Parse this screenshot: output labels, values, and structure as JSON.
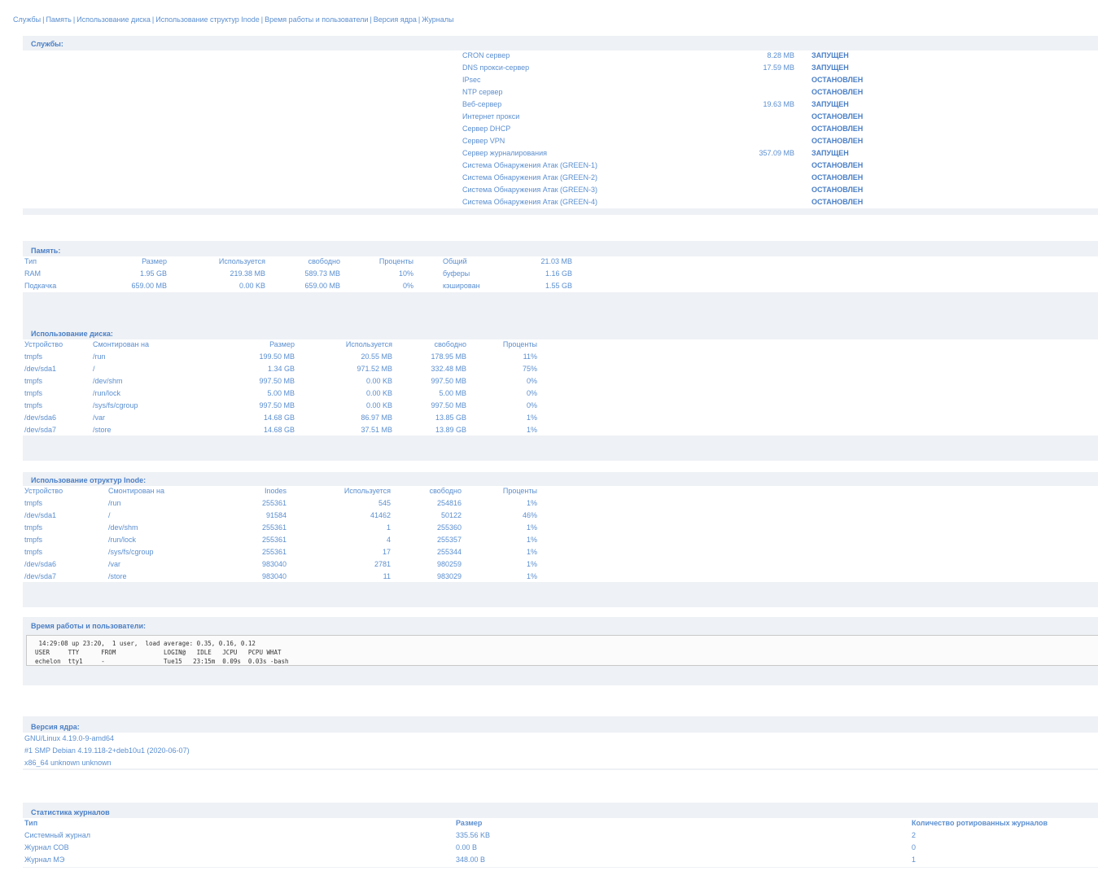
{
  "nav": {
    "links": [
      "Службы",
      "Память",
      "Использование диска",
      "Использование структур Inode",
      "Время работы и пользователи",
      "Версия ядра",
      "Журналы"
    ],
    "separator": "|"
  },
  "services": {
    "title": "Службы:",
    "items": [
      {
        "name": "CRON сервер",
        "memory": "8.28 MB",
        "status": "ЗАПУЩЕН"
      },
      {
        "name": "DNS прокси-сервер",
        "memory": "17.59 MB",
        "status": "ЗАПУЩЕН"
      },
      {
        "name": "IPsec",
        "memory": "",
        "status": "ОСТАНОВЛЕН"
      },
      {
        "name": "NTP сервер",
        "memory": "",
        "status": "ОСТАНОВЛЕН"
      },
      {
        "name": "Веб-сервер",
        "memory": "19.63 MB",
        "status": "ЗАПУЩЕН"
      },
      {
        "name": "Интернет прокси",
        "memory": "",
        "status": "ОСТАНОВЛЕН"
      },
      {
        "name": "Сервер DHCP",
        "memory": "",
        "status": "ОСТАНОВЛЕН"
      },
      {
        "name": "Сервер VPN",
        "memory": "",
        "status": "ОСТАНОВЛЕН"
      },
      {
        "name": "Сервер журналирования",
        "memory": "357.09 MB",
        "status": "ЗАПУЩЕН"
      },
      {
        "name": "Система Обнаружения Атак (GREEN-1)",
        "memory": "",
        "status": "ОСТАНОВЛЕН"
      },
      {
        "name": "Система Обнаружения Атак (GREEN-2)",
        "memory": "",
        "status": "ОСТАНОВЛЕН"
      },
      {
        "name": "Система Обнаружения Атак (GREEN-3)",
        "memory": "",
        "status": "ОСТАНОВЛЕН"
      },
      {
        "name": "Система Обнаружения Атак (GREEN-4)",
        "memory": "",
        "status": "ОСТАНОВЛЕН"
      }
    ]
  },
  "memory": {
    "title": "Память:",
    "headers": [
      "Тип",
      "Размер",
      "Используется",
      "свободно",
      "Проценты"
    ],
    "rows": [
      [
        "RAM",
        "1.95 GB",
        "219.38 MB",
        "589.73 MB",
        "10%"
      ],
      [
        "Подкачка",
        "659.00 MB",
        "0.00 KB",
        "659.00 MB",
        "0%"
      ]
    ],
    "extra": [
      [
        "Общий",
        "21.03 MB"
      ],
      [
        "буферы",
        "1.16 GB"
      ],
      [
        "кэширован",
        "1.55 GB"
      ]
    ]
  },
  "disk": {
    "title": "Использование диска:",
    "headers": [
      "Устройство",
      "Смонтирован на",
      "Размер",
      "Используется",
      "свободно",
      "Проценты"
    ],
    "rows": [
      [
        "tmpfs",
        "/run",
        "199.50 MB",
        "20.55 MB",
        "178.95 MB",
        "11%"
      ],
      [
        "/dev/sda1",
        "/",
        "1.34 GB",
        "971.52 MB",
        "332.48 MB",
        "75%"
      ],
      [
        "tmpfs",
        "/dev/shm",
        "997.50 MB",
        "0.00 KB",
        "997.50 MB",
        "0%"
      ],
      [
        "tmpfs",
        "/run/lock",
        "5.00 MB",
        "0.00 KB",
        "5.00 MB",
        "0%"
      ],
      [
        "tmpfs",
        "/sys/fs/cgroup",
        "997.50 MB",
        "0.00 KB",
        "997.50 MB",
        "0%"
      ],
      [
        "/dev/sda6",
        "/var",
        "14.68 GB",
        "86.97 MB",
        "13.85 GB",
        "1%"
      ],
      [
        "/dev/sda7",
        "/store",
        "14.68 GB",
        "37.51 MB",
        "13.89 GB",
        "1%"
      ]
    ]
  },
  "inode": {
    "title": "Использование отруктур Inode:",
    "headers": [
      "Устройство",
      "Смонтирован на",
      "Inodes",
      "Используется",
      "свободно",
      "Проценты"
    ],
    "rows": [
      [
        "tmpfs",
        "/run",
        "255361",
        "545",
        "254816",
        "1%"
      ],
      [
        "/dev/sda1",
        "/",
        "91584",
        "41462",
        "50122",
        "46%"
      ],
      [
        "tmpfs",
        "/dev/shm",
        "255361",
        "1",
        "255360",
        "1%"
      ],
      [
        "tmpfs",
        "/run/lock",
        "255361",
        "4",
        "255357",
        "1%"
      ],
      [
        "tmpfs",
        "/sys/fs/cgroup",
        "255361",
        "17",
        "255344",
        "1%"
      ],
      [
        "/dev/sda6",
        "/var",
        "983040",
        "2781",
        "980259",
        "1%"
      ],
      [
        "/dev/sda7",
        "/store",
        "983040",
        "11",
        "983029",
        "1%"
      ]
    ]
  },
  "uptime": {
    "title": "Время работы и пользователи:",
    "lines": [
      " 14:29:08 up 23:20,  1 user,  load average: 0.35, 0.16, 0.12",
      "USER     TTY      FROM             LOGIN@   IDLE   JCPU   PCPU WHAT",
      "echelon  tty1     -                Tue15   23:15m  0.09s  0.03s -bash"
    ]
  },
  "kernel": {
    "title": "Версия ядра:",
    "lines": [
      "GNU/Linux 4.19.0-9-amd64",
      "#1 SMP Debian 4.19.118-2+deb10u1 (2020-06-07)",
      "x86_64 unknown unknown"
    ]
  },
  "logs": {
    "title": "Статистика журналов",
    "headers": [
      "Тип",
      "Размер",
      "Количество ротированных журналов"
    ],
    "rows": [
      [
        "Системный журнал",
        "335.56 KB",
        "2"
      ],
      [
        "Журнал СОВ",
        "0.00 B",
        "0"
      ],
      [
        "Журнал МЭ",
        "348.00 B",
        "1"
      ]
    ]
  },
  "colors": {
    "link": "#5b8fd0",
    "heading": "#4a7fc6",
    "section_bg": "#eef1f5"
  }
}
